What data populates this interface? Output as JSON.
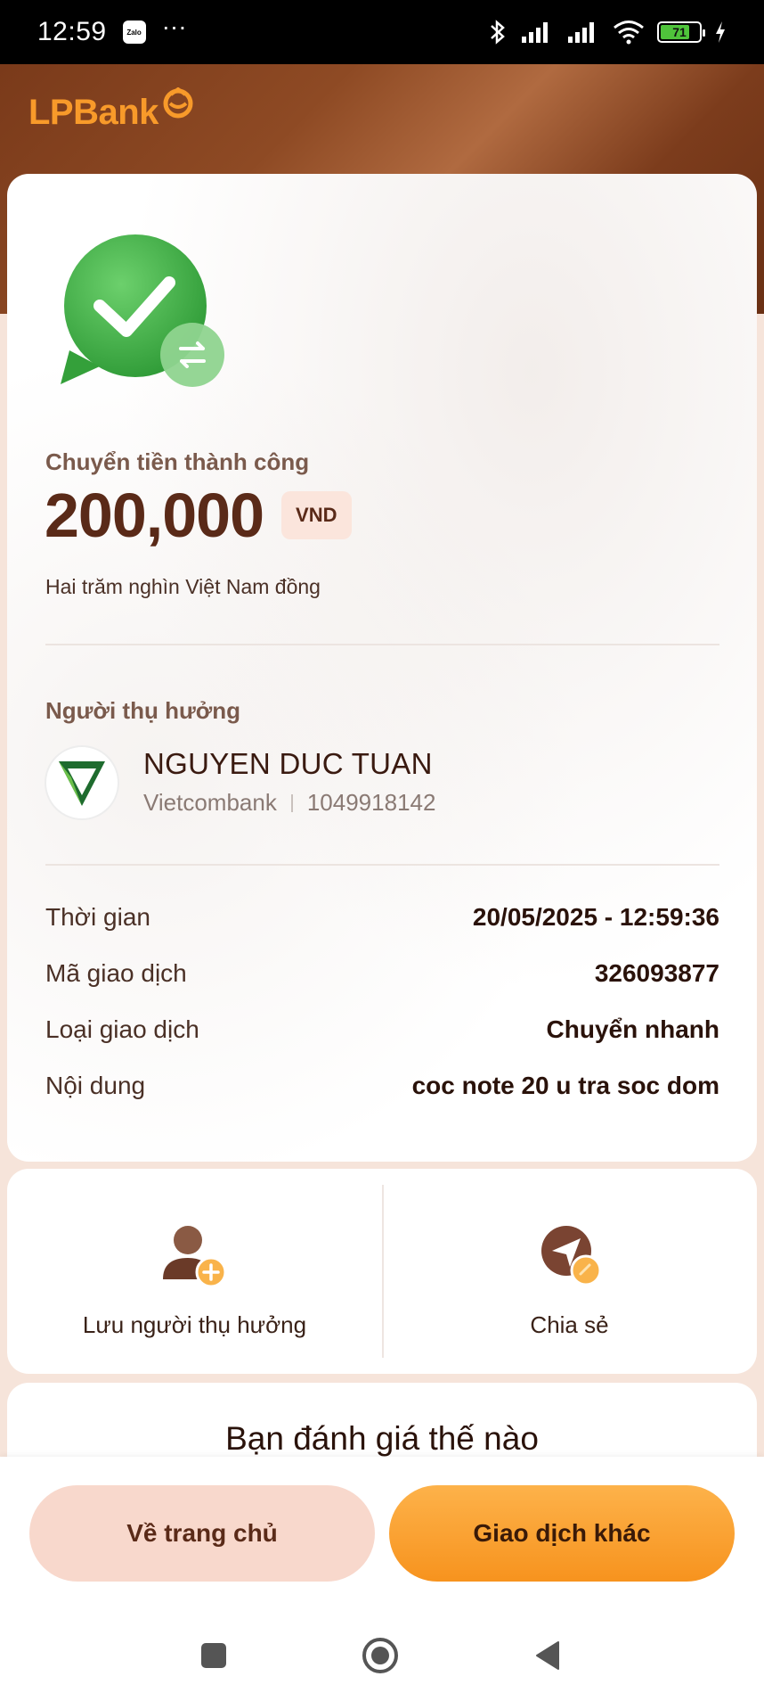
{
  "status_bar": {
    "time": "12:59",
    "zalo_label": "Zalo",
    "more": "···",
    "battery_level": "71"
  },
  "header": {
    "logo_text": "LPBank"
  },
  "receipt": {
    "title": "Chuyển tiền thành công",
    "amount": "200,000",
    "currency": "VND",
    "amount_in_words": "Hai trăm nghìn Việt Nam đồng",
    "beneficiary_label": "Người thụ hưởng",
    "beneficiary": {
      "name": "NGUYEN DUC TUAN",
      "bank": "Vietcombank",
      "account": "1049918142"
    },
    "details": [
      {
        "label": "Thời gian",
        "value": "20/05/2025 - 12:59:36"
      },
      {
        "label": "Mã giao dịch",
        "value": "326093877"
      },
      {
        "label": "Loại giao dịch",
        "value": "Chuyển nhanh"
      },
      {
        "label": "Nội dung",
        "value": "coc note 20 u tra soc dom"
      }
    ]
  },
  "actions": {
    "save_beneficiary": "Lưu người thụ hưởng",
    "share": "Chia sẻ"
  },
  "rating": {
    "title": "Bạn đánh giá thế nào"
  },
  "buttons": {
    "home": "Về trang chủ",
    "other_transaction": "Giao dịch khác"
  },
  "colors": {
    "brand_orange": "#f89a2a",
    "brand_brown": "#5a2a18",
    "success_green": "#3aa63a"
  }
}
